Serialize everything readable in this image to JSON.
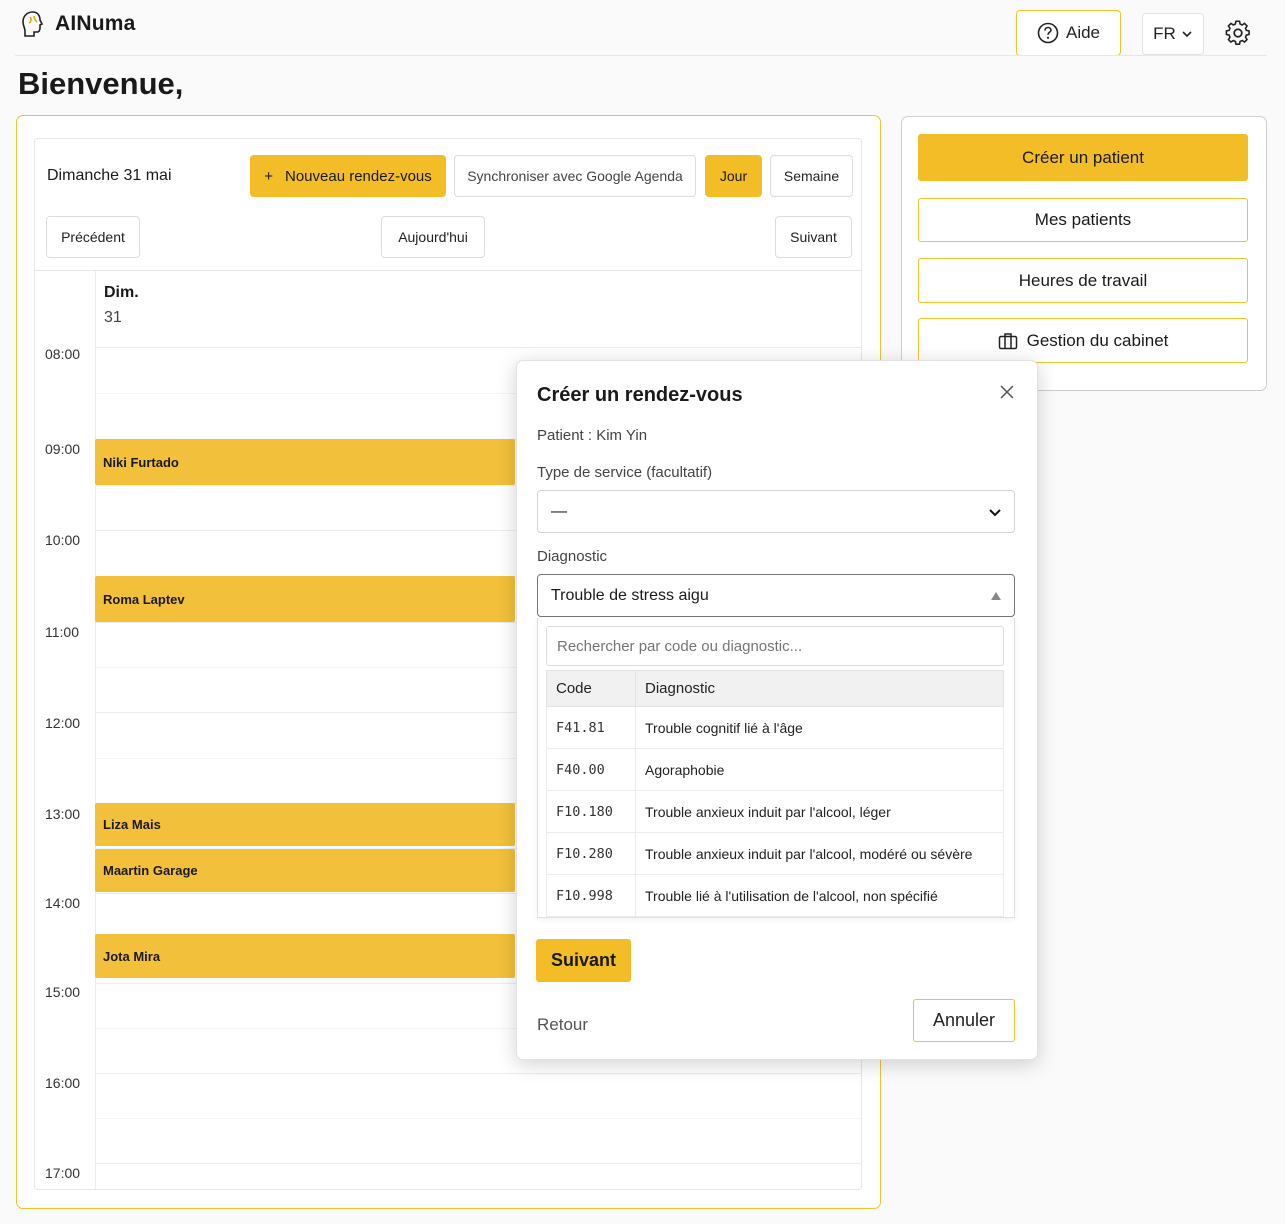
{
  "app": {
    "name": "AINuma"
  },
  "header": {
    "help_label": "Aide",
    "lang_label": "FR"
  },
  "welcome": "Bienvenue,",
  "calendar": {
    "date_label": "Dimanche 31 mai",
    "new_appointment": "Nouveau rendez-vous",
    "sync_google": "Synchroniser avec Google Agenda",
    "view_day": "Jour",
    "view_week": "Semaine",
    "prev": "Précédent",
    "today": "Aujourd'hui",
    "next": "Suivant",
    "day_name": "Dim.",
    "day_num": "31",
    "hours": [
      "08:00",
      "09:00",
      "10:00",
      "11:00",
      "12:00",
      "13:00",
      "14:00",
      "15:00",
      "16:00",
      "17:00"
    ],
    "events": [
      "Niki Furtado",
      "Roma Laptev",
      "Liza Mais",
      "Maartin Garage",
      "Jota Mira"
    ]
  },
  "side": {
    "create_patient": "Créer un patient",
    "my_patients": "Mes patients",
    "work_hours": "Heures de travail",
    "office_mgmt": "Gestion du cabinet"
  },
  "modal": {
    "title": "Créer un rendez-vous",
    "patient": "Patient : Kim Yin",
    "service_label": "Type de service (facultatif)",
    "service_value": "—",
    "diagnostic_label": "Diagnostic",
    "diagnostic_value": "Trouble de stress aigu",
    "search_placeholder": "Rechercher par code ou diagnostic...",
    "col_code": "Code",
    "col_diagnostic": "Diagnostic",
    "rows": [
      {
        "code": "F41.81",
        "label": "Trouble cognitif lié à l'âge"
      },
      {
        "code": "F40.00",
        "label": "Agoraphobie"
      },
      {
        "code": "F10.180",
        "label": "Trouble anxieux induit par l'alcool, léger"
      },
      {
        "code": "F10.280",
        "label": "Trouble anxieux induit par l'alcool, modéré ou sévère"
      },
      {
        "code": "F10.998",
        "label": "Trouble lié à l'utilisation de l'alcool, non spécifié"
      }
    ],
    "next": "Suivant",
    "back": "Retour",
    "cancel": "Annuler"
  },
  "colors": {
    "accent": "#f2bd26",
    "event": "#f2c03a"
  }
}
